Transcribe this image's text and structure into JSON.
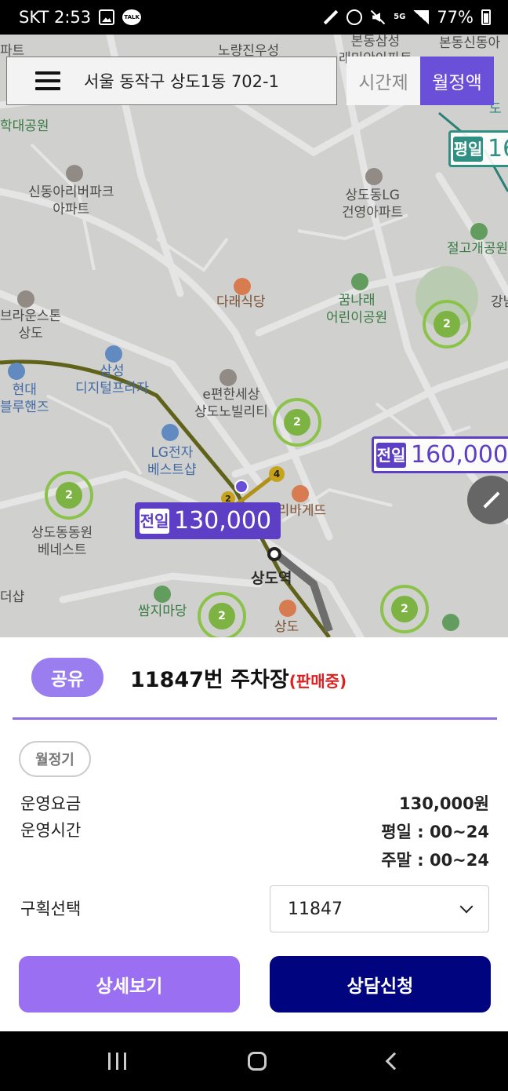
{
  "status_bar": {
    "carrier_time": "SKT 2:53",
    "talk_badge": "TALK",
    "network": "5G",
    "battery": "77%"
  },
  "search": {
    "address": "서울 동작구 상도1동 702-1"
  },
  "mode_tabs": [
    {
      "label": "시간제",
      "active": false
    },
    {
      "label": "월정액",
      "active": true
    }
  ],
  "map": {
    "labels": {
      "l1": "노량진우성",
      "l2": "본동삼성\n래미안아파트",
      "l3": "본동신동아",
      "l4": "학대공원",
      "l5": "신동아리버파크\n아파트",
      "l6": "상도동LG\n건영아파트",
      "l7": "절고개공원",
      "l8": "다래식당",
      "l9": "꿈나래\n어린이공원",
      "l10": "브라운스톤\n상도",
      "l11": "강남",
      "l12": "삼성\n디지털프라자",
      "l13": "현대\n블루핸즈",
      "l14": "e편한세상\n상도노빌리티",
      "l15": "LG전자\n베스트샵",
      "l16": "파리바게뜨",
      "l17": "상도동동원\n베네스트",
      "l18": "상도역",
      "l19": "더샵",
      "l20": "쌈지마당",
      "l21": "상도",
      "l22": "파트",
      "l23": "도"
    },
    "clusters": [
      "2",
      "2",
      "2",
      "2",
      "2",
      "2"
    ],
    "badges": [
      "4",
      "2"
    ],
    "price_markers": [
      {
        "tag": "평일",
        "amount": "16"
      },
      {
        "tag": "전일",
        "amount": "160,000"
      },
      {
        "tag": "전일",
        "amount": "130,000"
      }
    ]
  },
  "sheet": {
    "share_label": "공유",
    "lot_title": "11847번 주차장",
    "lot_status": "(판매중)",
    "type_chip": "월정기",
    "fee_label": "운영요금",
    "fee_value": "130,000원",
    "hours_label": "운영시간",
    "weekday_hours": "평일 : 00~24",
    "weekend_hours": "주말 : 00~24",
    "section_label": "구획선택",
    "section_value": "11847",
    "detail_button": "상세보기",
    "consult_button": "상담신청"
  },
  "colors": {
    "accent": "#6a4fd8",
    "price_purple": "#5c3fc4",
    "consult_navy": "#00047e",
    "cluster_green": "#7cb342",
    "status_red": "#e02020"
  }
}
